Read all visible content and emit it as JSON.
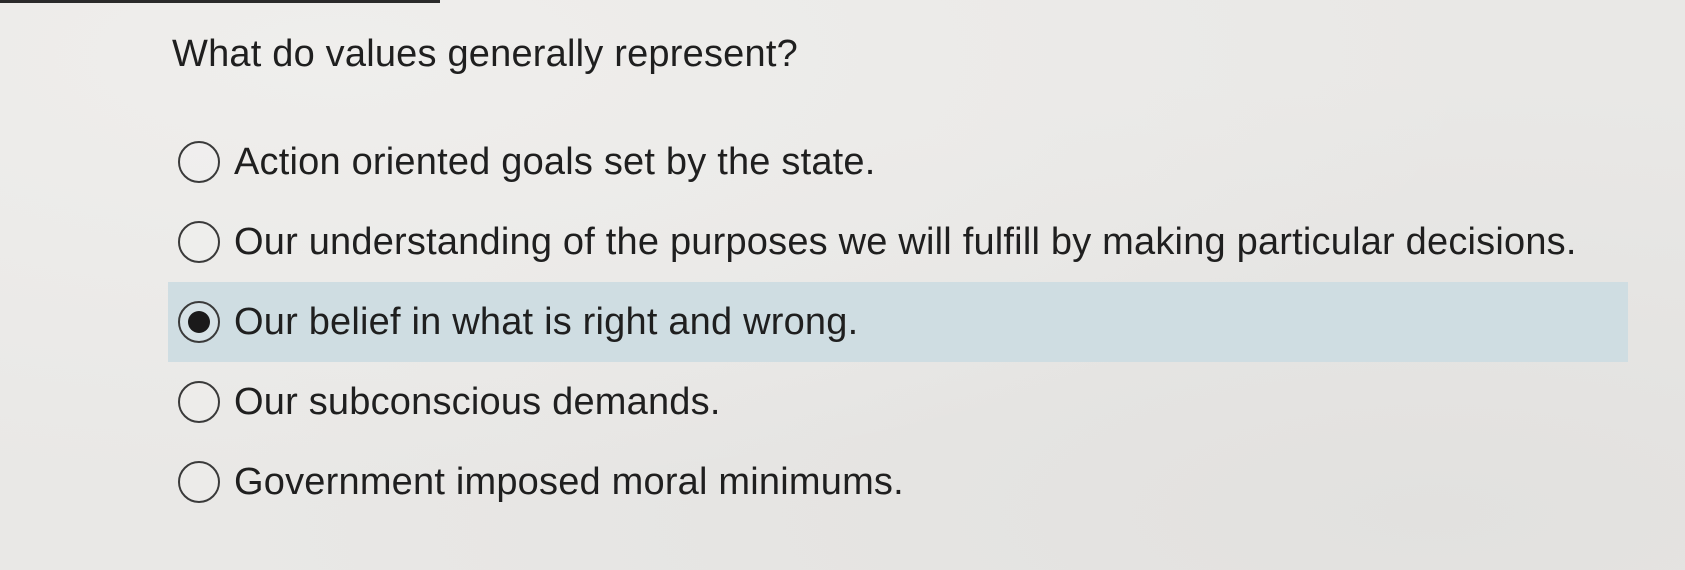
{
  "question": {
    "text": "What do values generally represent?"
  },
  "options": [
    {
      "label": "Action oriented goals set by the state.",
      "selected": false
    },
    {
      "label": "Our understanding of the purposes we will fulfill by making particular decisions.",
      "selected": false
    },
    {
      "label": "Our belief in what is right and wrong.",
      "selected": true
    },
    {
      "label": "Our subconscious demands.",
      "selected": false
    },
    {
      "label": "Government imposed moral minimums.",
      "selected": false
    }
  ],
  "colors": {
    "selected_highlight": "#cfdde2",
    "background": "#e9e8e6",
    "text": "#1f1f1f"
  }
}
